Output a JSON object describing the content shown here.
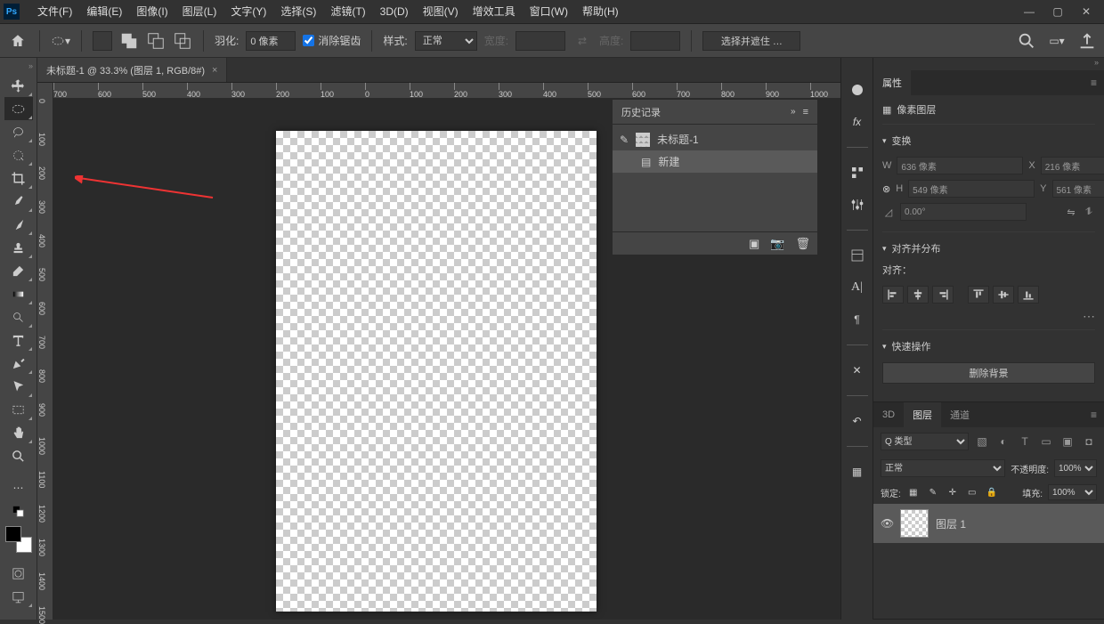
{
  "menu": {
    "file": "文件(F)",
    "edit": "编辑(E)",
    "image": "图像(I)",
    "layer": "图层(L)",
    "text": "文字(Y)",
    "select": "选择(S)",
    "filter": "滤镜(T)",
    "td": "3D(D)",
    "view": "视图(V)",
    "plugins": "增效工具",
    "window": "窗口(W)",
    "help": "帮助(H)"
  },
  "optbar": {
    "feather_lbl": "羽化:",
    "feather_val": "0 像素",
    "aa": "消除锯齿",
    "style_lbl": "样式:",
    "style_val": "正常",
    "w_lbl": "宽度:",
    "h_lbl": "高度:",
    "mask": "选择并遮住 …"
  },
  "doc": {
    "tab": "未标题-1 @ 33.3% (图层 1, RGB/8#)"
  },
  "ruler_h": [
    "700",
    "600",
    "500",
    "400",
    "300",
    "200",
    "100",
    "0",
    "100",
    "200",
    "300",
    "400",
    "500",
    "600",
    "700",
    "800",
    "900",
    "1000"
  ],
  "history": {
    "title": "历史记录",
    "doc": "未标题-1",
    "new": "新建"
  },
  "props": {
    "tab": "属性",
    "pixel": "像素图层",
    "transform": "变换",
    "w": "W",
    "w_val": "636 像素",
    "x": "X",
    "x_val": "216 像素",
    "h": "H",
    "h_val": "549 像素",
    "y": "Y",
    "y_val": "561 像素",
    "angle": "0.00°",
    "align": "对齐并分布",
    "align_lbl": "对齐：",
    "quick": "快速操作",
    "remove": "删除背景"
  },
  "layers": {
    "tab3d": "3D",
    "tabLayer": "图层",
    "tabChannel": "通道",
    "kind": "Q 类型",
    "blend": "正常",
    "opacity_lbl": "不透明度:",
    "opacity": "100%",
    "lock": "锁定:",
    "fill_lbl": "填充:",
    "fill": "100%",
    "layer1": "图层 1"
  }
}
